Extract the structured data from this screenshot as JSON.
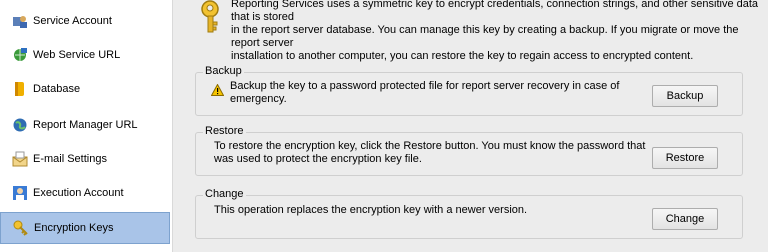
{
  "sidebar": {
    "items": [
      {
        "label": "Service Account",
        "icon": "service-account-icon",
        "selected": false
      },
      {
        "label": "Web Service URL",
        "icon": "web-service-icon",
        "selected": false
      },
      {
        "label": "Database",
        "icon": "database-icon",
        "selected": false
      },
      {
        "label": "Report Manager URL",
        "icon": "globe-icon",
        "selected": false
      },
      {
        "label": "E-mail Settings",
        "icon": "email-icon",
        "selected": false
      },
      {
        "label": "Execution Account",
        "icon": "execution-account-icon",
        "selected": false
      },
      {
        "label": "Encryption Keys",
        "icon": "key-icon",
        "selected": true
      }
    ]
  },
  "main": {
    "intro_line1": "Reporting Services uses a symmetric key to encrypt credentials, connection strings, and other sensitive data that is stored",
    "intro_line2": "in the report server database.  You can manage this key by creating a backup.  If you migrate or move the report server",
    "intro_line3": "installation to another computer, you can restore the key to regain access to encrypted content.",
    "backup": {
      "legend": "Backup",
      "desc_line1": "Backup the key to a password protected file for report server recovery in case of",
      "desc_line2": "emergency.",
      "button": "Backup"
    },
    "restore": {
      "legend": "Restore",
      "desc_line1": "To restore the encryption key, click the Restore button.  You must know the password that",
      "desc_line2": "was used to protect the encryption key file.",
      "button": "Restore"
    },
    "change": {
      "legend": "Change",
      "desc_line1": "This operation replaces the encryption key with a newer version.",
      "button": "Change"
    }
  },
  "colors": {
    "selected_bg": "#a9c4e8",
    "panel_bg": "#ececec",
    "warning": "#f5c400"
  }
}
